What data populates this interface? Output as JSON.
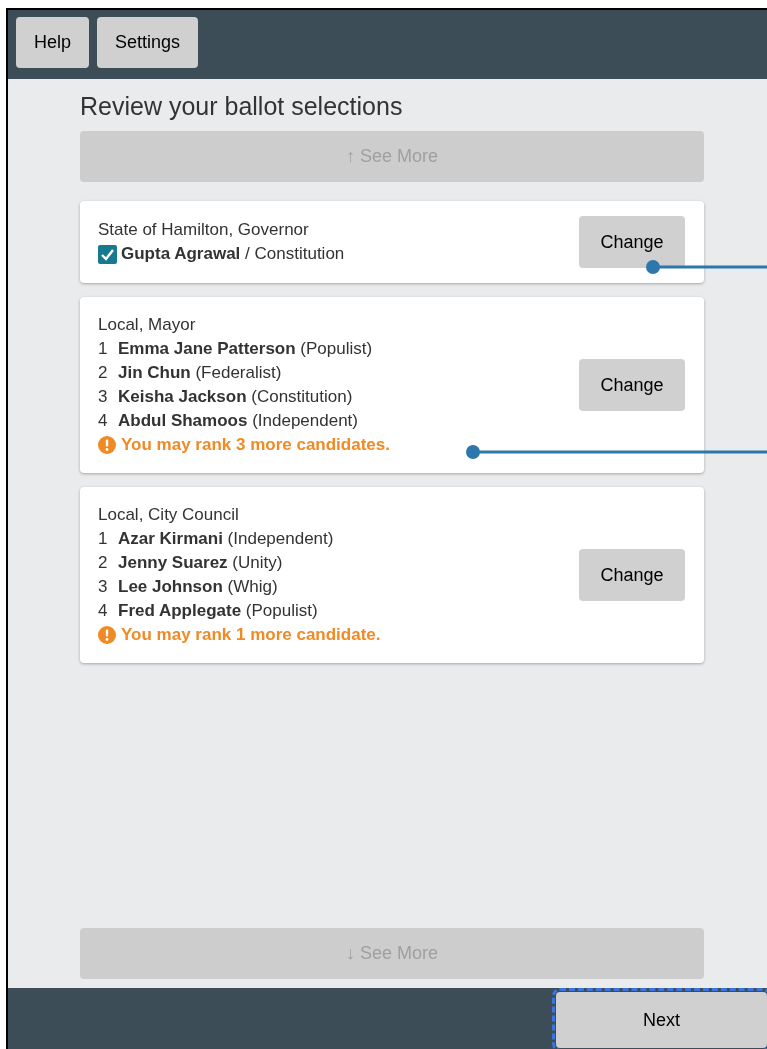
{
  "top_bar": {
    "buttons": [
      "Help",
      "Settings"
    ]
  },
  "title": "Review your ballot selections",
  "see_more_top": {
    "label": "↑ See More",
    "disabled": true
  },
  "contests": [
    {
      "kind": "single",
      "title": "State of Hamilton, Governor",
      "selections": [
        {
          "text": "**Gupta Agrawal** / Constitution",
          "checked": true
        }
      ],
      "button": "Change"
    },
    {
      "kind": "ranked",
      "title": "Local, Mayor",
      "selections": [
        {
          "rank": "1",
          "text": "**Emma Jane Patterson** (Populist)"
        },
        {
          "rank": "2",
          "text": "**Jin Chun** (Federalist)"
        },
        {
          "rank": "3",
          "text": "**Keisha Jackson** (Constitution)"
        },
        {
          "rank": "4",
          "text": "**Abdul Shamoos** (Independent)"
        }
      ],
      "warning": "You may rank 3 more candidates.",
      "button": "Change"
    },
    {
      "kind": "ranked",
      "title": "Local, City Council",
      "selections": [
        {
          "rank": "1",
          "text": "**Azar Kirmani** (Independent)"
        },
        {
          "rank": "2",
          "text": "**Jenny Suarez** (Unity)"
        },
        {
          "rank": "3",
          "text": "**Lee Johnson** (Whig)"
        },
        {
          "rank": "4",
          "text": "**Fred Applegate** (Populist)"
        }
      ],
      "warning": "You may rank 1 more candidate.",
      "button": "Change"
    }
  ],
  "see_more_bottom": {
    "label": "↓ See More",
    "disabled": true
  },
  "bottom_bar": {
    "next": {
      "label": "Next",
      "focused": true
    }
  }
}
